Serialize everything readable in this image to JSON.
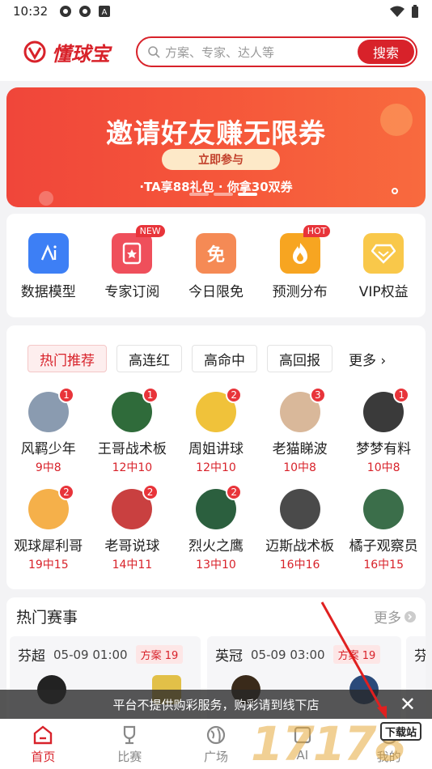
{
  "status": {
    "time": "10:32"
  },
  "header": {
    "logo": "懂球宝",
    "search_placeholder": "方案、专家、达人等",
    "search_button": "搜索"
  },
  "banner": {
    "title": "邀请好友赚无限券",
    "join": "立即参与",
    "subtitle": "·TA享88礼包 · 你拿30双券"
  },
  "features": [
    {
      "label": "数据模型",
      "color": "#3d7ff5",
      "icon": "data-model-icon",
      "tag": ""
    },
    {
      "label": "专家订阅",
      "color": "#ef4f5b",
      "icon": "bookmark-icon",
      "tag": "NEW"
    },
    {
      "label": "今日限免",
      "color": "#f58a55",
      "icon": "free-icon",
      "glyph": "免",
      "tag": ""
    },
    {
      "label": "预测分布",
      "color": "#f7a521",
      "icon": "fire-icon",
      "tag": "HOT"
    },
    {
      "label": "VIP权益",
      "color": "#f9c84a",
      "icon": "diamond-icon",
      "tag": ""
    }
  ],
  "hot": {
    "tabs": [
      "热门推荐",
      "高连红",
      "高命中",
      "高回报"
    ],
    "more": "更多",
    "experts": [
      {
        "name": "风羁少年",
        "record": "9中8",
        "badge": "1",
        "color": "#8a9bb0"
      },
      {
        "name": "王哥战术板",
        "record": "12中10",
        "badge": "1",
        "color": "#2f6b3a"
      },
      {
        "name": "周姐讲球",
        "record": "12中10",
        "badge": "2",
        "color": "#f0c23a"
      },
      {
        "name": "老猫睇波",
        "record": "10中8",
        "badge": "3",
        "color": "#d9b89a"
      },
      {
        "name": "梦梦有料",
        "record": "10中8",
        "badge": "1",
        "color": "#3a3a3a"
      },
      {
        "name": "观球犀利哥",
        "record": "19中15",
        "badge": "2",
        "color": "#f5b04a"
      },
      {
        "name": "老哥说球",
        "record": "14中11",
        "badge": "2",
        "color": "#c94040"
      },
      {
        "name": "烈火之鹰",
        "record": "13中10",
        "badge": "2",
        "color": "#2b5f3e"
      },
      {
        "name": "迈斯战术板",
        "record": "16中16",
        "badge": "",
        "color": "#4a4a4a"
      },
      {
        "name": "橘子观察员",
        "record": "16中15",
        "badge": "",
        "color": "#3b6e4a"
      }
    ]
  },
  "matches": {
    "title": "热门赛事",
    "more": "更多",
    "cards": [
      {
        "league": "芬超",
        "time": "05-09 01:00",
        "plans": "方案 19"
      },
      {
        "league": "英冠",
        "time": "05-09 03:00",
        "plans": "方案 19"
      },
      {
        "league": "芬",
        "time": "",
        "plans": ""
      }
    ]
  },
  "toast": {
    "text": "平台不提供购彩服务，购彩请到线下店"
  },
  "nav": [
    {
      "label": "首页",
      "icon": "home-icon"
    },
    {
      "label": "比赛",
      "icon": "trophy-icon"
    },
    {
      "label": "广场",
      "icon": "globe-icon"
    },
    {
      "label": "AI",
      "icon": "ai-icon"
    },
    {
      "label": "我的",
      "icon": "user-icon"
    }
  ],
  "watermark": {
    "digits": "17178",
    "site": "下载站"
  }
}
